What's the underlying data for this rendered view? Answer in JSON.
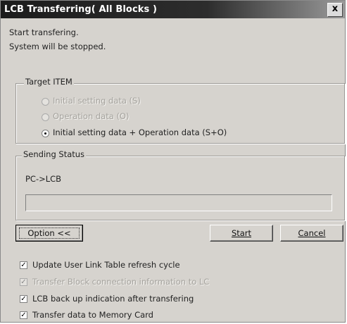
{
  "window": {
    "title": "LCB Transferring( All Blocks )",
    "close_glyph": "x"
  },
  "messages": {
    "line1": "Start transfering.",
    "line2": "System will be stopped."
  },
  "target_item": {
    "legend": "Target ITEM",
    "options": [
      {
        "label": "Initial setting data (S)",
        "checked": false,
        "enabled": false
      },
      {
        "label": "Operation data (O)",
        "checked": false,
        "enabled": false
      },
      {
        "label": "Initial setting data + Operation data (S+O)",
        "checked": true,
        "enabled": true
      }
    ]
  },
  "sending_status": {
    "legend": "Sending Status",
    "direction": "PC->LCB",
    "progress": 0
  },
  "buttons": {
    "option": "Option <<",
    "start": "Start",
    "cancel": "Cancel"
  },
  "checkboxes": [
    {
      "label": "Update User Link Table refresh cycle",
      "checked": true,
      "enabled": true
    },
    {
      "label": "Transfer Block connection information to LC",
      "checked": true,
      "enabled": false
    },
    {
      "label": "LCB back up indication after transfering",
      "checked": true,
      "enabled": true
    },
    {
      "label": "Transfer data to Memory Card",
      "checked": true,
      "enabled": true
    }
  ],
  "colors": {
    "titlebar": "#1c1c1c",
    "face": "#d6d3ce",
    "disabled_text": "#a5a39e"
  },
  "icons": {
    "close": "close-icon",
    "check": "check-icon"
  }
}
